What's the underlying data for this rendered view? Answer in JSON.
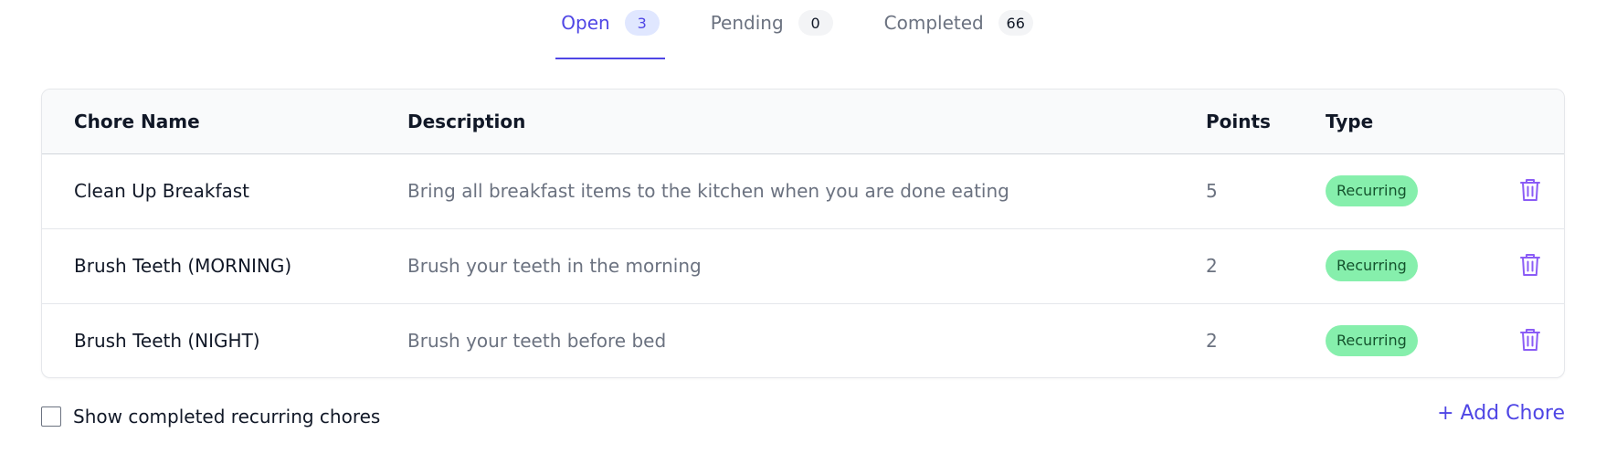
{
  "tabs": [
    {
      "label": "Open",
      "count": "3",
      "active": true
    },
    {
      "label": "Pending",
      "count": "0",
      "active": false
    },
    {
      "label": "Completed",
      "count": "66",
      "active": false
    }
  ],
  "table": {
    "headers": {
      "name": "Chore Name",
      "description": "Description",
      "points": "Points",
      "type": "Type"
    },
    "rows": [
      {
        "name": "Clean Up Breakfast",
        "description": "Bring all breakfast items to the kitchen when you are done eating",
        "points": "5",
        "type": "Recurring"
      },
      {
        "name": "Brush Teeth (MORNING)",
        "description": "Brush your teeth in the morning",
        "points": "2",
        "type": "Recurring"
      },
      {
        "name": "Brush Teeth (NIGHT)",
        "description": "Brush your teeth before bed",
        "points": "2",
        "type": "Recurring"
      }
    ]
  },
  "footer": {
    "checkbox_label": "Show completed recurring chores",
    "checkbox_checked": false,
    "add_chore_label": "+ Add Chore"
  },
  "icons": {
    "delete": "trash-icon"
  },
  "colors": {
    "accent": "#4f46e5",
    "badge_bg": "#86efac",
    "trash": "#8b5cf6"
  }
}
